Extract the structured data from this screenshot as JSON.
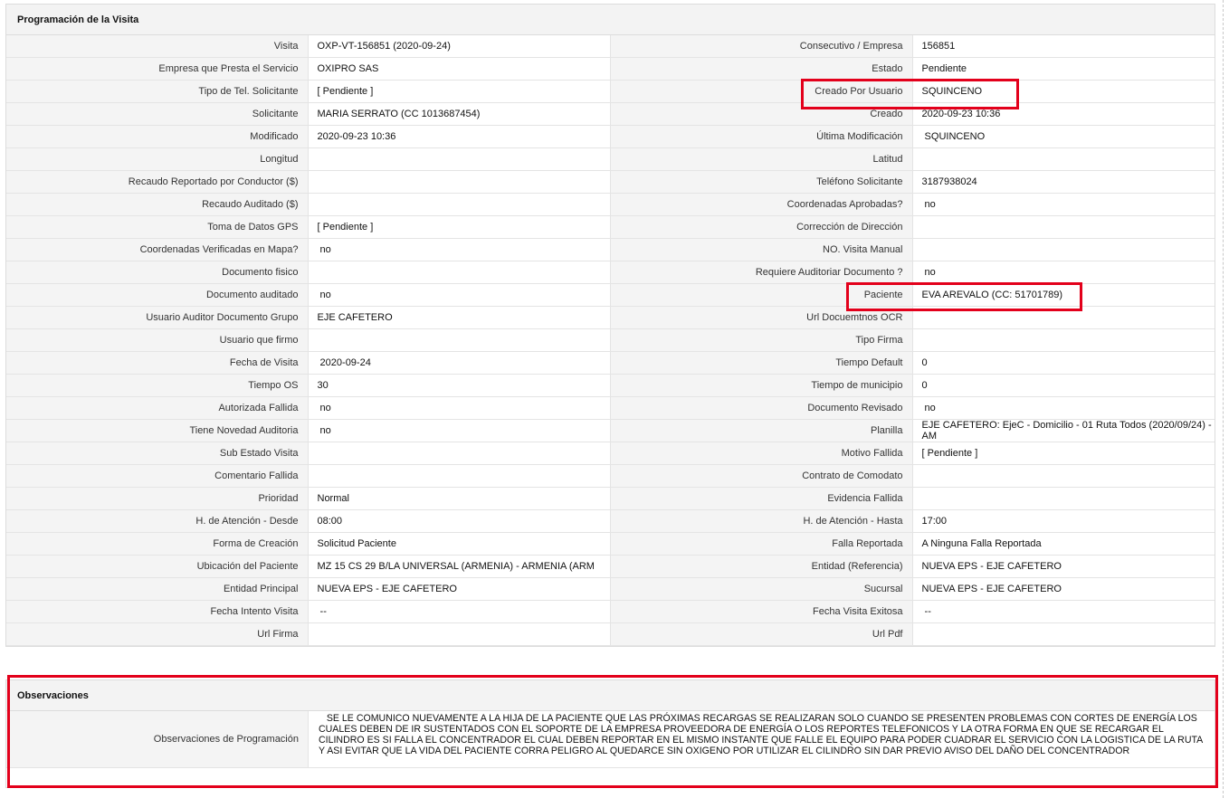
{
  "programacion": {
    "title": "Programación de la Visita",
    "rows": [
      {
        "l1": "Visita",
        "v1": "OXP-VT-156851 (2020-09-24)",
        "l2": "Consecutivo / Empresa",
        "v2": "156851"
      },
      {
        "l1": "Empresa que Presta el Servicio",
        "v1": "OXIPRO SAS",
        "l2": "Estado",
        "v2": "Pendiente"
      },
      {
        "l1": "Tipo de Tel. Solicitante",
        "v1": "[ Pendiente ]",
        "l2": "Creado Por Usuario",
        "v2": "SQUINCENO"
      },
      {
        "l1": "Solicitante",
        "v1": "MARIA SERRATO (CC 1013687454)",
        "l2": "Creado",
        "v2": "2020-09-23 10:36"
      },
      {
        "l1": "Modificado",
        "v1": "2020-09-23 10:36",
        "l2": "Última Modificación",
        "v2": " SQUINCENO"
      },
      {
        "l1": "Longitud",
        "v1": "",
        "l2": "Latitud",
        "v2": ""
      },
      {
        "l1": "Recaudo Reportado por Conductor ($)",
        "v1": "",
        "l2": "Teléfono Solicitante",
        "v2": "3187938024"
      },
      {
        "l1": "Recaudo Auditado ($)",
        "v1": "",
        "l2": "Coordenadas Aprobadas?",
        "v2": " no"
      },
      {
        "l1": "Toma de Datos GPS",
        "v1": "[ Pendiente ]",
        "l2": "Corrección de Dirección",
        "v2": ""
      },
      {
        "l1": "Coordenadas Verificadas en Mapa?",
        "v1": " no",
        "l2": "NO. Visita Manual",
        "v2": ""
      },
      {
        "l1": "Documento fisico",
        "v1": "",
        "l2": "Requiere Auditoriar Documento ?",
        "v2": " no"
      },
      {
        "l1": "Documento auditado",
        "v1": " no",
        "l2": "Paciente",
        "v2": "EVA AREVALO (CC: 51701789)"
      },
      {
        "l1": "Usuario Auditor Documento Grupo",
        "v1": "EJE CAFETERO",
        "l2": "Url Docuemtnos OCR",
        "v2": ""
      },
      {
        "l1": "Usuario que firmo",
        "v1": "",
        "l2": "Tipo Firma",
        "v2": ""
      },
      {
        "l1": "Fecha de Visita",
        "v1": " 2020-09-24",
        "l2": "Tiempo Default",
        "v2": "0"
      },
      {
        "l1": "Tiempo OS",
        "v1": "30",
        "l2": "Tiempo de municipio",
        "v2": "0"
      },
      {
        "l1": "Autorizada Fallida",
        "v1": " no",
        "l2": "Documento Revisado",
        "v2": " no"
      },
      {
        "l1": "Tiene Novedad Auditoria",
        "v1": " no",
        "l2": "Planilla",
        "v2": "EJE CAFETERO: EjeC - Domicilio - 01 Ruta Todos (2020/09/24) - AM"
      },
      {
        "l1": "Sub Estado Visita",
        "v1": "",
        "l2": "Motivo Fallida",
        "v2": "[ Pendiente ]"
      },
      {
        "l1": "Comentario Fallida",
        "v1": "",
        "l2": "Contrato de Comodato",
        "v2": ""
      },
      {
        "l1": "Prioridad",
        "v1": "Normal",
        "l2": "Evidencia Fallida",
        "v2": ""
      },
      {
        "l1": "H. de Atención - Desde",
        "v1": "08:00",
        "l2": "H. de Atención - Hasta",
        "v2": "17:00"
      },
      {
        "l1": "Forma de Creación",
        "v1": "Solicitud Paciente",
        "l2": "Falla Reportada",
        "v2": "A Ninguna Falla Reportada"
      },
      {
        "l1": "Ubicación del Paciente",
        "v1": "MZ 15 CS 29 B/LA UNIVERSAL (ARMENIA) - ARMENIA (ARM",
        "l2": "Entidad (Referencia)",
        "v2": "NUEVA EPS - EJE CAFETERO"
      },
      {
        "l1": "Entidad Principal",
        "v1": "NUEVA EPS - EJE CAFETERO",
        "l2": "Sucursal",
        "v2": "NUEVA EPS - EJE CAFETERO"
      },
      {
        "l1": "Fecha Intento Visita",
        "v1": " --",
        "l2": "Fecha Visita Exitosa",
        "v2": " --"
      },
      {
        "l1": "Url Firma",
        "v1": "",
        "l2": "Url Pdf",
        "v2": ""
      }
    ]
  },
  "observaciones": {
    "title": "Observaciones",
    "label": "Observaciones de Programación",
    "text": "   SE LE COMUNICO NUEVAMENTE A LA HIJA DE LA PACIENTE QUE LAS PRÓXIMAS RECARGAS SE REALIZARAN SOLO CUANDO SE PRESENTEN PROBLEMAS CON CORTES DE ENERGÍA LOS CUALES DEBEN DE IR SUSTENTADOS CON EL SOPORTE DE LA EMPRESA PROVEEDORA DE ENERGÍA O LOS REPORTES TELEFONICOS Y LA OTRA FORMA EN QUE SE RECARGAR EL CILINDRO ES SI FALLA EL CONCENTRADOR EL CUAL DEBEN REPORTAR EN EL MISMO INSTANTE QUE FALLE EL EQUIPO PARA PODER CUADRAR EL SERVICIO CON LA LOGISTICA DE LA RUTA Y ASI EVITAR QUE LA VIDA DEL PACIENTE CORRA PELIGRO AL QUEDARCE SIN OXIGENO POR UTILIZAR EL CILINDRO SIN DAR PREVIO AVISO DEL DAÑO DEL CONCENTRADOR"
  },
  "colors": {
    "highlight": "#e3001b",
    "header_bg": "#f3f3f3",
    "label_bg": "#f4f4f4"
  }
}
